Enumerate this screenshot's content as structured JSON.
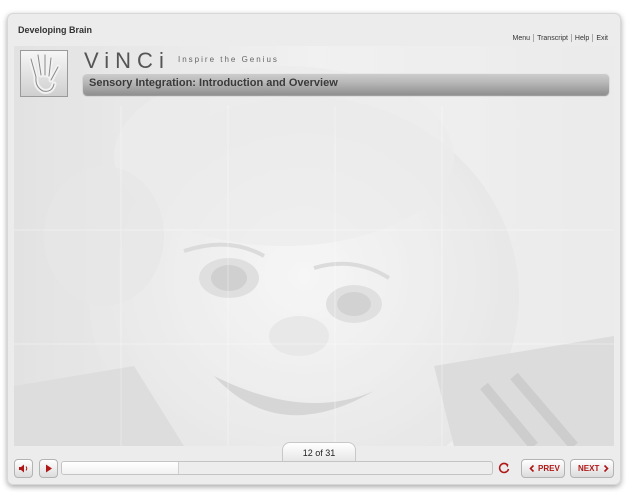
{
  "course_title": "Developing Brain",
  "topnav": {
    "items": [
      "Menu",
      "Transcript",
      "Help",
      "Exit"
    ]
  },
  "brand": {
    "name": "ViNCi",
    "tagline": "Inspire the Genius"
  },
  "module_title": "Sensory Integration: Introduction and Overview",
  "pager": {
    "text": "12 of 31",
    "current": 12,
    "total": 31
  },
  "controls": {
    "prev_label": "PREV",
    "next_label": "NEXT",
    "progress_fraction": 0.27
  },
  "colors": {
    "accent": "#b01818",
    "titlebar": "#a8a8a8"
  },
  "icons": [
    "hand-logo-icon",
    "volume-icon",
    "play-icon",
    "replay-icon",
    "chevron-left-icon",
    "chevron-right-icon"
  ]
}
